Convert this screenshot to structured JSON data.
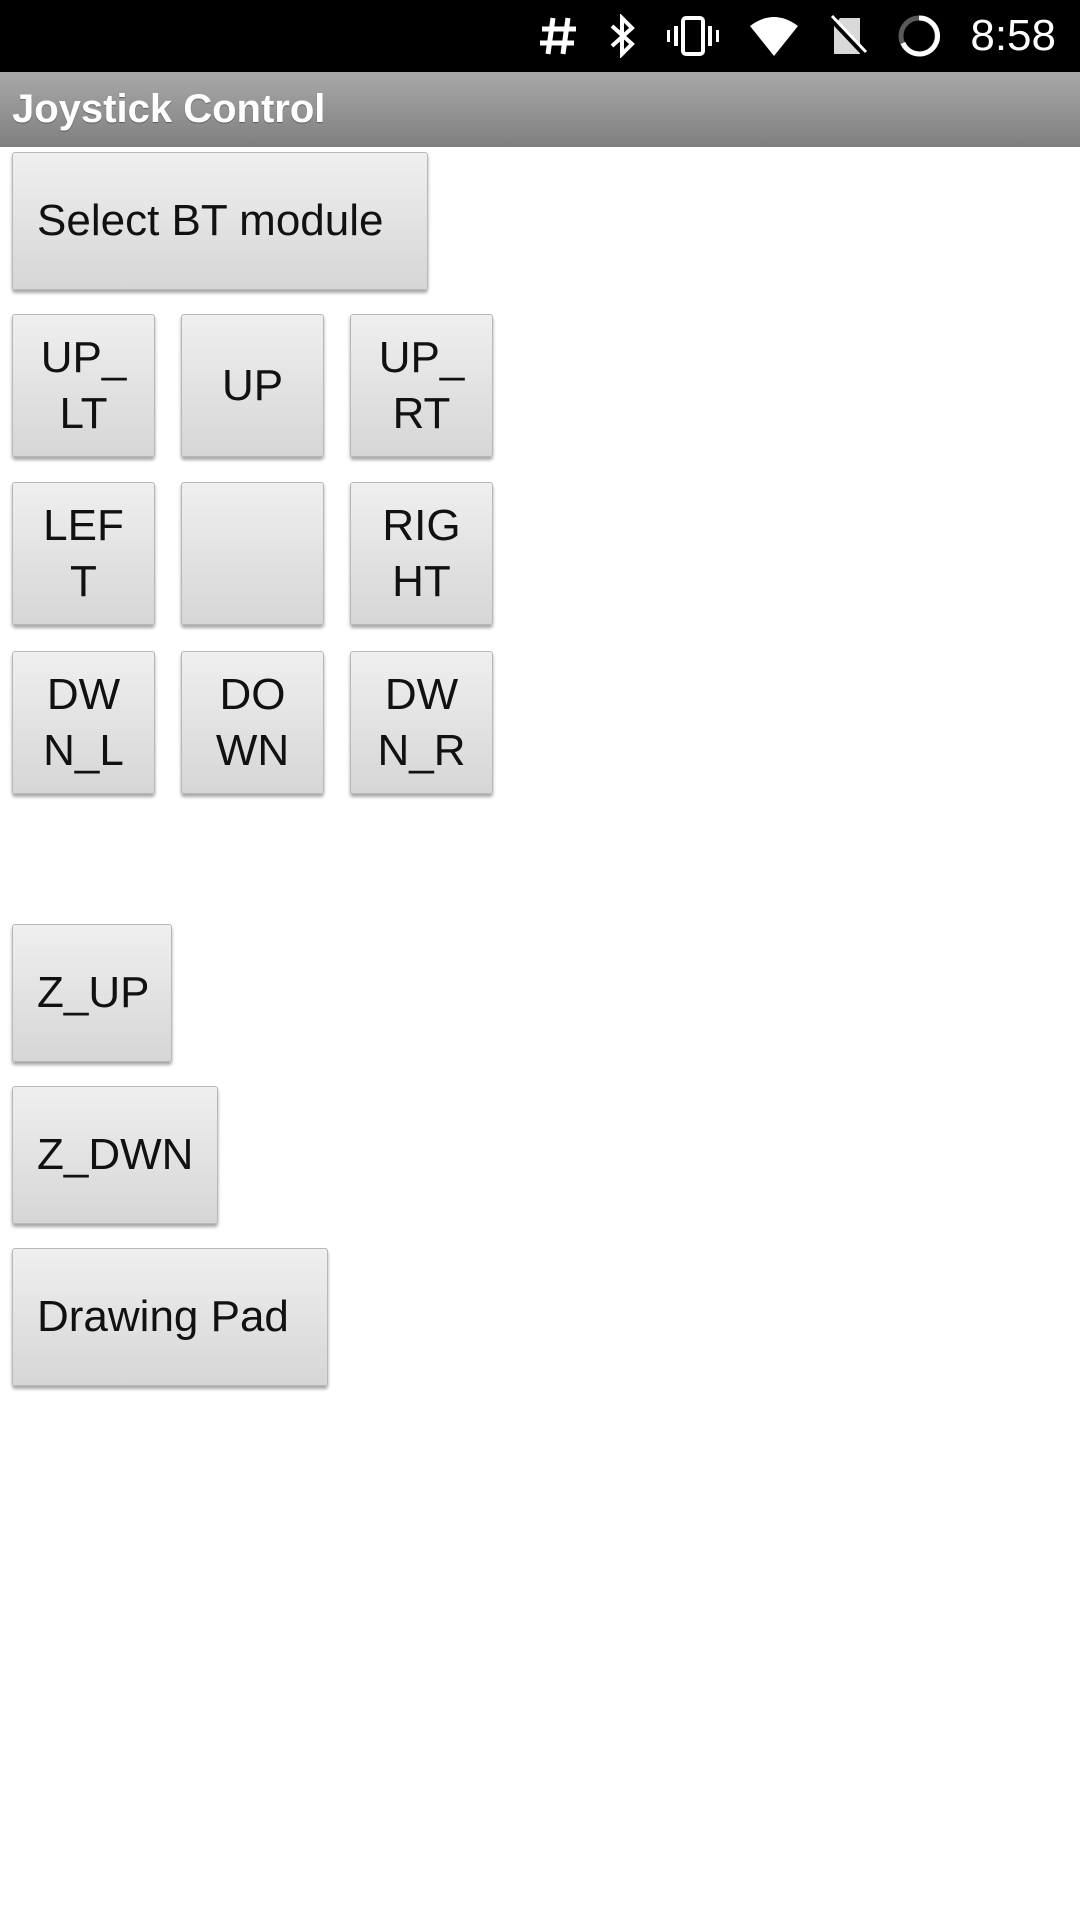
{
  "status_bar": {
    "time": "8:58",
    "icons": [
      "hash-icon",
      "bluetooth-icon",
      "vibrate-icon",
      "wifi-icon",
      "no-sim-icon",
      "battery-charging-icon"
    ]
  },
  "app_bar": {
    "title": "Joystick Control"
  },
  "buttons": {
    "select_bt": "Select BT module",
    "up_left": "UP_\nLT",
    "up": "UP",
    "up_right": "UP_\nRT",
    "left": "LEF\nT",
    "center": "",
    "right": "RIG\nHT",
    "down_left": "DW\nN_L",
    "down": "DO\nWN",
    "down_right": "DW\nN_R",
    "z_up": "Z_UP",
    "z_down": "Z_DWN",
    "drawing_pad": "Drawing Pad"
  }
}
